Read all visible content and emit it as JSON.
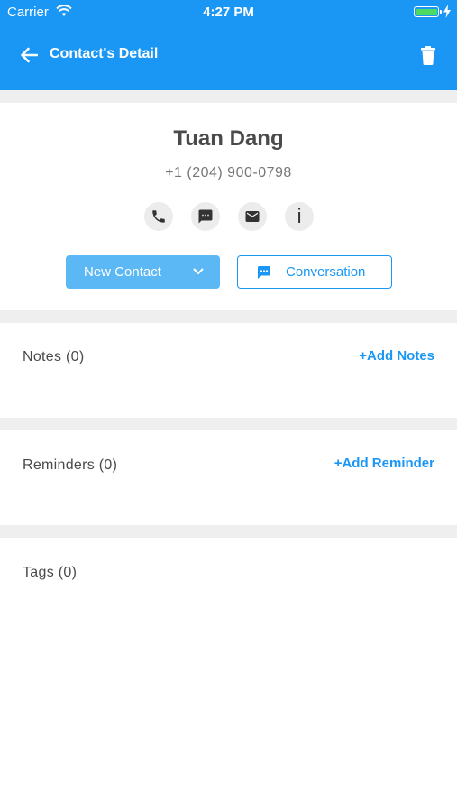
{
  "status_bar": {
    "carrier": "Carrier",
    "time": "4:27 PM"
  },
  "nav": {
    "title": "Contact's Detail"
  },
  "contact": {
    "name": "Tuan Dang",
    "phone": "+1 (204) 900-0798"
  },
  "actions": {
    "info_glyph": "i"
  },
  "buttons": {
    "new_contact": "New Contact",
    "conversation": "Conversation"
  },
  "sections": {
    "notes": {
      "title": "Notes (0)",
      "link": "+Add Notes"
    },
    "reminders": {
      "title": "Reminders (0)",
      "link": "+Add Reminder"
    },
    "tags": {
      "title": "Tags (0)"
    }
  },
  "colors": {
    "primary": "#1a97f5",
    "button_fill": "#5bb8f5",
    "battery": "#4cd964",
    "divider": "#efefef"
  }
}
